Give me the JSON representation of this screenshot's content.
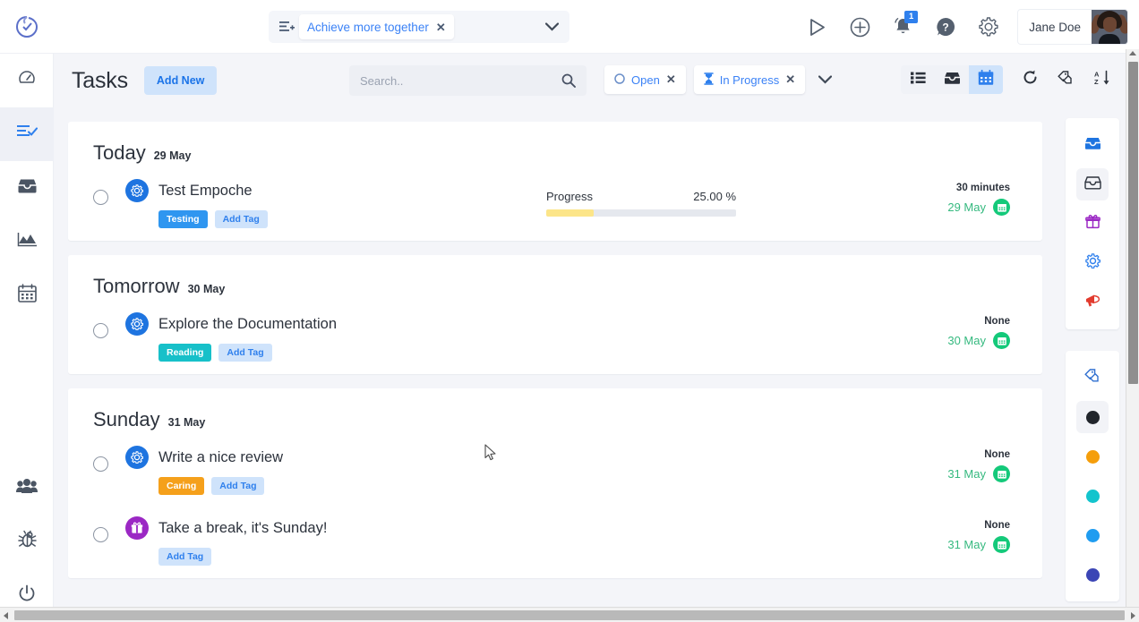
{
  "topbar": {
    "logo_icon": "clock-check-logo",
    "project": {
      "list_icon": "list-add-icon",
      "name": "Achieve more together",
      "close_icon": "close-icon",
      "caret_icon": "chevron-down-icon"
    },
    "actions": [
      {
        "name": "play-button",
        "icon": "play-icon"
      },
      {
        "name": "add-button",
        "icon": "plus-circle-icon"
      },
      {
        "name": "notifications-button",
        "icon": "bell-icon",
        "badge": "1"
      },
      {
        "name": "help-button",
        "icon": "question-circle-icon"
      },
      {
        "name": "settings-button",
        "icon": "gear-icon"
      }
    ],
    "user": {
      "name": "Jane Doe",
      "avatar_icon": "user-avatar"
    }
  },
  "sidebar": {
    "items": [
      {
        "name": "sidebar-item-dashboard",
        "icon": "gauge-icon",
        "active": false
      },
      {
        "name": "sidebar-item-tasks",
        "icon": "tasks-check-icon",
        "active": true
      },
      {
        "name": "sidebar-item-inbox",
        "icon": "inbox-icon",
        "active": false
      },
      {
        "name": "sidebar-item-reports",
        "icon": "chart-area-icon",
        "active": false
      },
      {
        "name": "sidebar-item-calendar",
        "icon": "calendar-icon",
        "active": false
      }
    ],
    "bottom_items": [
      {
        "name": "sidebar-item-team",
        "icon": "users-icon"
      },
      {
        "name": "sidebar-item-bugs",
        "icon": "bug-icon"
      },
      {
        "name": "sidebar-item-logout",
        "icon": "power-icon"
      }
    ]
  },
  "pageheader": {
    "title": "Tasks",
    "add_new_label": "Add New",
    "search": {
      "value": "",
      "placeholder": "Search.."
    },
    "filters": [
      {
        "label": "Open",
        "icon": "circle-icon",
        "close": "✕"
      },
      {
        "label": "In Progress",
        "icon": "hourglass-icon",
        "close": "✕"
      }
    ],
    "filter_caret_icon": "chevron-down-icon",
    "views": [
      {
        "name": "view-list",
        "icon": "list-icon",
        "active": false
      },
      {
        "name": "view-board",
        "icon": "inbox-icon",
        "active": false
      },
      {
        "name": "view-calendar",
        "icon": "calendar-icon",
        "active": true
      }
    ],
    "tools": [
      {
        "name": "refresh-button",
        "icon": "refresh-icon"
      },
      {
        "name": "tags-button",
        "icon": "tag-icon"
      },
      {
        "name": "sort-button",
        "icon": "sort-alpha-icon"
      }
    ]
  },
  "groups": [
    {
      "day": "Today",
      "date": "29 May",
      "tasks": [
        {
          "title": "Test Empoche",
          "avatar_icon": "gear-icon",
          "avatar_color": "#1e74e0",
          "tags": [
            {
              "label": "Testing",
              "color": "#2f96f0"
            }
          ],
          "add_tag_label": "Add Tag",
          "progress": {
            "label": "Progress",
            "value": "25.00 %",
            "percent": 25,
            "color": "#fce589"
          },
          "duration": "30 minutes",
          "date": "29 May",
          "date_icon": "calendar-icon"
        }
      ]
    },
    {
      "day": "Tomorrow",
      "date": "30 May",
      "tasks": [
        {
          "title": "Explore the Documentation",
          "avatar_icon": "gear-icon",
          "avatar_color": "#1e74e0",
          "tags": [
            {
              "label": "Reading",
              "color": "#17c0c9"
            }
          ],
          "add_tag_label": "Add Tag",
          "progress": null,
          "duration": "None",
          "date": "30 May",
          "date_icon": "calendar-icon"
        }
      ]
    },
    {
      "day": "Sunday",
      "date": "31 May",
      "tasks": [
        {
          "title": "Write a nice review",
          "avatar_icon": "gear-icon",
          "avatar_color": "#1e74e0",
          "tags": [
            {
              "label": "Caring",
              "color": "#f5a01b"
            }
          ],
          "add_tag_label": "Add Tag",
          "progress": null,
          "duration": "None",
          "date": "31 May",
          "date_icon": "calendar-icon"
        },
        {
          "title": "Take a break, it's Sunday!",
          "avatar_icon": "gift-icon",
          "avatar_color": "#9b28c4",
          "tags": [],
          "add_tag_label": "Add Tag",
          "progress": null,
          "duration": "None",
          "date": "31 May",
          "date_icon": "calendar-icon"
        }
      ]
    }
  ],
  "rightrail": {
    "panel1": [
      {
        "name": "rail-inbox-blue",
        "icon": "inbox-icon",
        "color": "#1e74e0",
        "active": false
      },
      {
        "name": "rail-inbox-dark",
        "icon": "inbox-icon",
        "color": "#2c323c",
        "active": true
      },
      {
        "name": "rail-gift",
        "icon": "gift-icon",
        "color": "#9b28c4",
        "active": false
      },
      {
        "name": "rail-settings",
        "icon": "gear-icon",
        "color": "#2f80ed",
        "active": false
      },
      {
        "name": "rail-announce",
        "icon": "megaphone-icon",
        "color": "#e23b2e",
        "active": false
      }
    ],
    "panel2": [
      {
        "name": "rail-tags",
        "icon": "tag-icon",
        "color": "#2f6fd0",
        "active": false,
        "type": "icon"
      },
      {
        "name": "rail-color-black",
        "color": "#21252b",
        "active": true,
        "type": "dot"
      },
      {
        "name": "rail-color-orange",
        "color": "#f59e0b",
        "active": false,
        "type": "dot"
      },
      {
        "name": "rail-color-teal",
        "color": "#13c4cd",
        "active": false,
        "type": "dot"
      },
      {
        "name": "rail-color-blue",
        "color": "#1f9cf0",
        "active": false,
        "type": "dot"
      },
      {
        "name": "rail-color-indigo",
        "color": "#3b45b5",
        "active": false,
        "type": "dot"
      }
    ]
  },
  "scrollbars": {
    "vertical_name": "vertical-scrollbar",
    "horizontal_name": "horizontal-scrollbar"
  }
}
